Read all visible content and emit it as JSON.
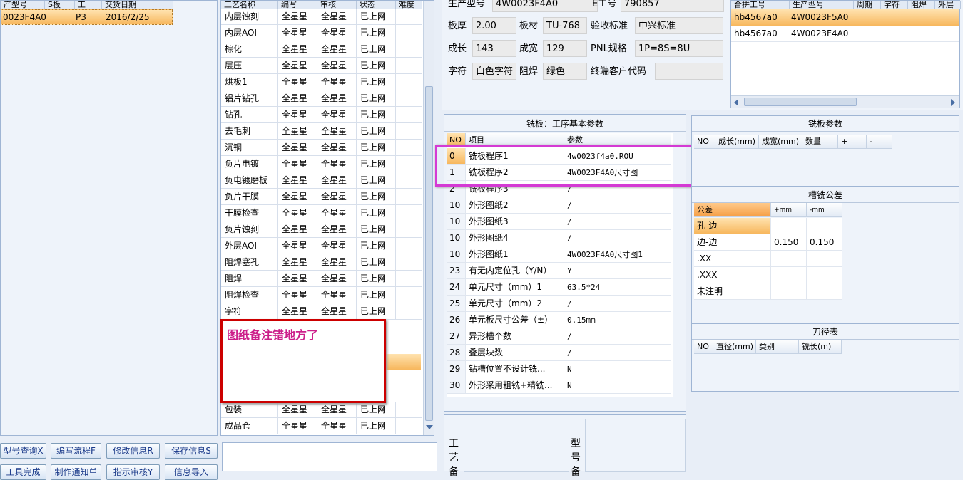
{
  "left_list": {
    "headers": [
      "产型号",
      "S板",
      "工",
      "交货日期"
    ],
    "row": {
      "model": "0023F4A0",
      "s": "",
      "gong": "P3",
      "date": "2016/2/25"
    }
  },
  "buttons_row1": [
    "型号查询X",
    "编写流程F",
    "修改信息R",
    "保存信息S"
  ],
  "buttons_row2": [
    "工具完成",
    "制作通知单",
    "指示审核Y",
    "信息导入"
  ],
  "process": {
    "headers": [
      "工艺名称",
      "编写",
      "审核",
      "状态",
      "难度"
    ],
    "rows": [
      [
        "内层蚀刻",
        "全星星",
        "全星星",
        "已上网"
      ],
      [
        "内层AOI",
        "全星星",
        "全星星",
        "已上网"
      ],
      [
        "棕化",
        "全星星",
        "全星星",
        "已上网"
      ],
      [
        "层压",
        "全星星",
        "全星星",
        "已上网"
      ],
      [
        "烘板1",
        "全星星",
        "全星星",
        "已上网"
      ],
      [
        "铝片钻孔",
        "全星星",
        "全星星",
        "已上网"
      ],
      [
        "钻孔",
        "全星星",
        "全星星",
        "已上网"
      ],
      [
        "去毛刺",
        "全星星",
        "全星星",
        "已上网"
      ],
      [
        "沉铜",
        "全星星",
        "全星星",
        "已上网"
      ],
      [
        "负片电镀",
        "全星星",
        "全星星",
        "已上网"
      ],
      [
        "负电镀磨板",
        "全星星",
        "全星星",
        "已上网"
      ],
      [
        "负片干膜",
        "全星星",
        "全星星",
        "已上网"
      ],
      [
        "干膜检查",
        "全星星",
        "全星星",
        "已上网"
      ],
      [
        "负片蚀刻",
        "全星星",
        "全星星",
        "已上网"
      ],
      [
        "外层AOI",
        "全星星",
        "全星星",
        "已上网"
      ],
      [
        "阻焊塞孔",
        "全星星",
        "全星星",
        "已上网"
      ],
      [
        "阻焊",
        "全星星",
        "全星星",
        "已上网"
      ],
      [
        "阻焊检查",
        "全星星",
        "全星星",
        "已上网"
      ],
      [
        "字符",
        "全星星",
        "全星星",
        "已上网"
      ]
    ],
    "bottom_rows": [
      [
        "包装",
        "全星星",
        "全星星",
        "已上网"
      ],
      [
        "成品仓",
        "全星星",
        "全星星",
        "已上网"
      ]
    ]
  },
  "annotation": {
    "text": "图纸备注错地方了",
    "color": "#cc1f8a"
  },
  "info": {
    "model_label": "生产型号",
    "model_value": "4W0023F4A0",
    "eno_label": "E工号",
    "eno_value": "790857",
    "thick_label": "板厚",
    "thick_value": "2.00",
    "mat_label": "板材",
    "mat_value": "TU-768",
    "std_label": "验收标准",
    "std_value": "中兴标准",
    "len_label": "成长",
    "len_value": "143",
    "wid_label": "成宽",
    "wid_value": "129",
    "pnl_label": "PNL规格",
    "pnl_value": "1P=8S=8U",
    "char_label": "字符",
    "char_value": "白色字符",
    "mask_label": "阻焊",
    "mask_value": "绿色",
    "cust_label": "终端客户代码",
    "cust_value": ""
  },
  "combo": {
    "headers": [
      "合拼工号",
      "生产型号",
      "周期",
      "字符",
      "阻焊",
      "外层"
    ],
    "rows": [
      [
        "hb4567a0",
        "4W0023F5A0"
      ],
      [
        "hb4567a0",
        "4W0023F4A0"
      ]
    ]
  },
  "mill": {
    "title": "铣板：工序基本参数",
    "headers": [
      "NO",
      "项目",
      "参数"
    ],
    "rows": [
      [
        "0",
        "铣板程序1",
        "4w0023f4a0.ROU"
      ],
      [
        "1",
        "铣板程序2",
        "4W0023F4A0尺寸图"
      ],
      [
        "2",
        "铣板程序3",
        "/"
      ],
      [
        "10",
        "外形图纸2",
        "/"
      ],
      [
        "10",
        "外形图纸3",
        "/"
      ],
      [
        "10",
        "外形图纸4",
        "/"
      ],
      [
        "10",
        "外形图纸1",
        "4W0023F4A0尺寸图1"
      ],
      [
        "23",
        "有无内定位孔（Y/N）",
        "Y"
      ],
      [
        "24",
        "单元尺寸（mm）1",
        "63.5*24"
      ],
      [
        "25",
        "单元尺寸（mm）2",
        "/"
      ],
      [
        "26",
        "单元板尺寸公差（±）",
        "0.15mm"
      ],
      [
        "27",
        "异形槽个数",
        "/"
      ],
      [
        "28",
        "叠层块数",
        "/"
      ],
      [
        "29",
        "钻槽位置不设计铣...",
        "N"
      ],
      [
        "30",
        "外形采用粗铣+精铣...",
        "N"
      ]
    ]
  },
  "mill_params": {
    "title": "铣板参数",
    "headers": [
      "NO",
      "成长(mm)",
      "成宽(mm)",
      "数量",
      "+",
      "-"
    ]
  },
  "slot": {
    "title": "槽铣公差",
    "headers": [
      "公差",
      "+mm",
      "-mm"
    ],
    "rows": [
      [
        "孔-边",
        "",
        ""
      ],
      [
        "边-边",
        "0.150",
        "0.150"
      ],
      [
        ".XX",
        "",
        ""
      ],
      [
        ".XXX",
        "",
        ""
      ],
      [
        "未注明",
        "",
        ""
      ]
    ]
  },
  "tool": {
    "title": "刀径表",
    "headers": [
      "NO",
      "直径(mm)",
      "类别",
      "铣长(m)"
    ]
  },
  "bottom": {
    "craft_label": "工艺备",
    "model_label": "型号备"
  }
}
